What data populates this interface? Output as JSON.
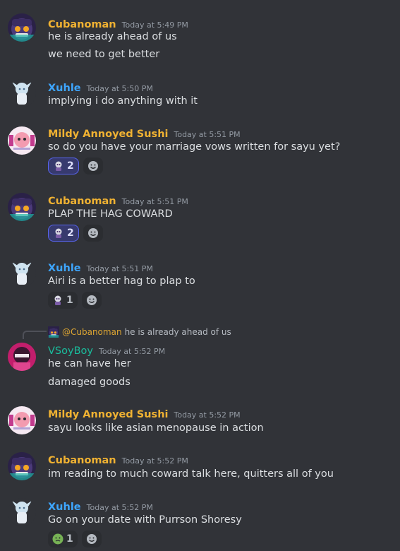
{
  "colors": {
    "cubanoman": "#f0b232",
    "xuhle": "#3ea6ff",
    "sushi": "#f0b232",
    "vsoyboy": "#1abc9c"
  },
  "messages": [
    {
      "user": "Cubanoman",
      "time": "Today at 5:49 PM",
      "lines": [
        "he is already ahead of us",
        "we need to get better"
      ]
    },
    {
      "user": "Xuhle",
      "time": "Today at 5:50 PM",
      "lines": [
        "implying i do anything with it"
      ]
    },
    {
      "user": "Mildy Annoyed Sushi",
      "time": "Today at 5:51 PM",
      "lines": [
        "so do you have your marriage vows written for sayu yet?"
      ],
      "reaction_count": "2"
    },
    {
      "user": "Cubanoman",
      "time": "Today at 5:51 PM",
      "lines": [
        "PLAP THE HAG COWARD"
      ],
      "reaction_count": "2"
    },
    {
      "user": "Xuhle",
      "time": "Today at 5:51 PM",
      "lines": [
        "Airi is a better hag to plap to"
      ],
      "reaction_count": "1"
    },
    {
      "reply_mention": "@Cubanoman",
      "reply_text": "he is already ahead of us",
      "user": "VSoyBoy",
      "time": "Today at 5:52 PM",
      "lines": [
        "he can have her",
        "damaged goods"
      ]
    },
    {
      "user": "Mildy Annoyed Sushi",
      "time": "Today at 5:52 PM",
      "lines": [
        "sayu looks like asian menopause in action"
      ]
    },
    {
      "user": "Cubanoman",
      "time": "Today at 5:52 PM",
      "lines": [
        "im reading to much coward talk here, quitters all of you"
      ]
    },
    {
      "user": "Xuhle",
      "time": "Today at 5:52 PM",
      "lines": [
        "Go on your date with Purrson Shoresy"
      ],
      "reaction_count": "1"
    }
  ]
}
